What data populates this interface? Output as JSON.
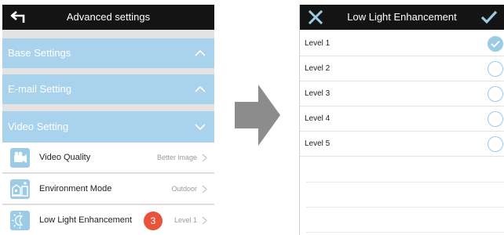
{
  "left_screen": {
    "header_title": "Advanced settings",
    "sections": [
      {
        "label": "Base Settings",
        "state": "collapsed"
      },
      {
        "label": "E-mail Setting",
        "state": "collapsed"
      },
      {
        "label": "Video Setting",
        "state": "expanded"
      }
    ],
    "items": [
      {
        "label": "Video Quality",
        "value": "Better image",
        "icon": "video-camera-icon"
      },
      {
        "label": "Environment Mode",
        "value": "Outdoor",
        "icon": "environment-icon"
      },
      {
        "label": "Low Light Enhancement",
        "value": "Level 1",
        "icon": "low-light-icon"
      }
    ],
    "step_badge": "3"
  },
  "right_screen": {
    "header_title": "Low Light Enhancement",
    "options": [
      {
        "label": "Level 1",
        "selected": true
      },
      {
        "label": "Level 2",
        "selected": false
      },
      {
        "label": "Level 3",
        "selected": false
      },
      {
        "label": "Level 4",
        "selected": false
      },
      {
        "label": "Level 5",
        "selected": false
      }
    ]
  },
  "colors": {
    "header_bg": "#141414",
    "section_bg": "#a9d3ec",
    "accent": "#9ccbe6",
    "badge": "#e8543a",
    "flow_arrow": "#8c8c8c"
  }
}
